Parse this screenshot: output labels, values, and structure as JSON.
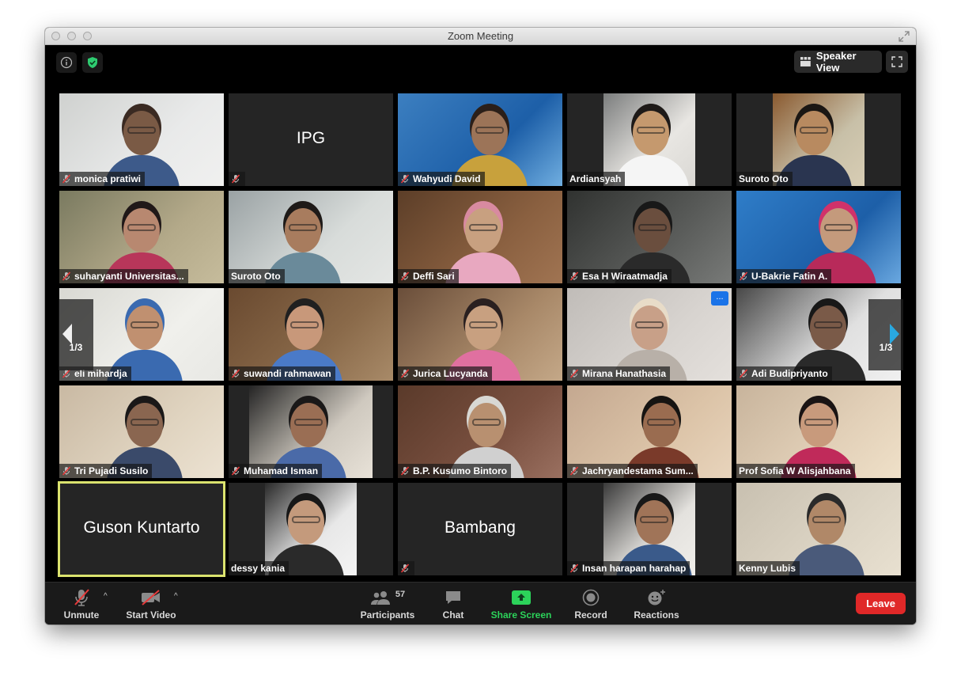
{
  "window": {
    "title": "Zoom Meeting"
  },
  "topbar": {
    "view_label": "Speaker View"
  },
  "tiles": [
    {
      "name": "monica pratiwi",
      "muted": true,
      "video": true
    },
    {
      "name": "",
      "muted": true,
      "video": false,
      "display_text": "IPG"
    },
    {
      "name": "Wahyudi David",
      "muted": true,
      "video": true
    },
    {
      "name": "Ardiansyah",
      "muted": false,
      "video": true
    },
    {
      "name": "Suroto Oto",
      "muted": false,
      "video": true
    },
    {
      "name": "suharyanti Universitas...",
      "muted": true,
      "video": true
    },
    {
      "name": "Suroto Oto",
      "muted": false,
      "video": true
    },
    {
      "name": "Deffi Sari",
      "muted": true,
      "video": true
    },
    {
      "name": "Esa H Wiraatmadja",
      "muted": true,
      "video": true
    },
    {
      "name": "U-Bakrie Fatin A.",
      "muted": true,
      "video": true
    },
    {
      "name": "eli mihardja",
      "muted": true,
      "video": true
    },
    {
      "name": "suwandi rahmawan",
      "muted": true,
      "video": true
    },
    {
      "name": "Jurica Lucyanda",
      "muted": true,
      "video": true
    },
    {
      "name": "Mirana Hanathasia",
      "muted": true,
      "video": true
    },
    {
      "name": "Adi Budipriyanto",
      "muted": true,
      "video": true
    },
    {
      "name": "Tri Pujadi Susilo",
      "muted": true,
      "video": true
    },
    {
      "name": "Muhamad Isman",
      "muted": true,
      "video": true
    },
    {
      "name": "B.P. Kusumo Bintoro",
      "muted": true,
      "video": true
    },
    {
      "name": "Jachryandestama Sum...",
      "muted": true,
      "video": true
    },
    {
      "name": "Prof Sofia W Alisjahbana",
      "muted": false,
      "video": true
    },
    {
      "name": "",
      "muted": false,
      "video": false,
      "display_text": "Guson Kuntarto",
      "active": true
    },
    {
      "name": "dessy kania",
      "muted": false,
      "video": true
    },
    {
      "name": "",
      "muted": true,
      "video": false,
      "display_text": "Bambang"
    },
    {
      "name": "Insan harapan harahap",
      "muted": true,
      "video": true
    },
    {
      "name": "Kenny Lubis",
      "muted": false,
      "video": true
    }
  ],
  "pager": {
    "left": "1/3",
    "right": "1/3"
  },
  "more_label": "...",
  "toolbar": {
    "unmute": "Unmute",
    "start_video": "Start Video",
    "participants": "Participants",
    "participants_count": "57",
    "chat": "Chat",
    "share_screen": "Share Screen",
    "record": "Record",
    "reactions": "Reactions",
    "leave": "Leave"
  },
  "colors": {
    "share_green": "#2cd35a",
    "leave_red": "#e02828",
    "active_speaker": "#dbe36e",
    "mute_red": "#e63a3a",
    "security_green": "#2ecc71"
  }
}
